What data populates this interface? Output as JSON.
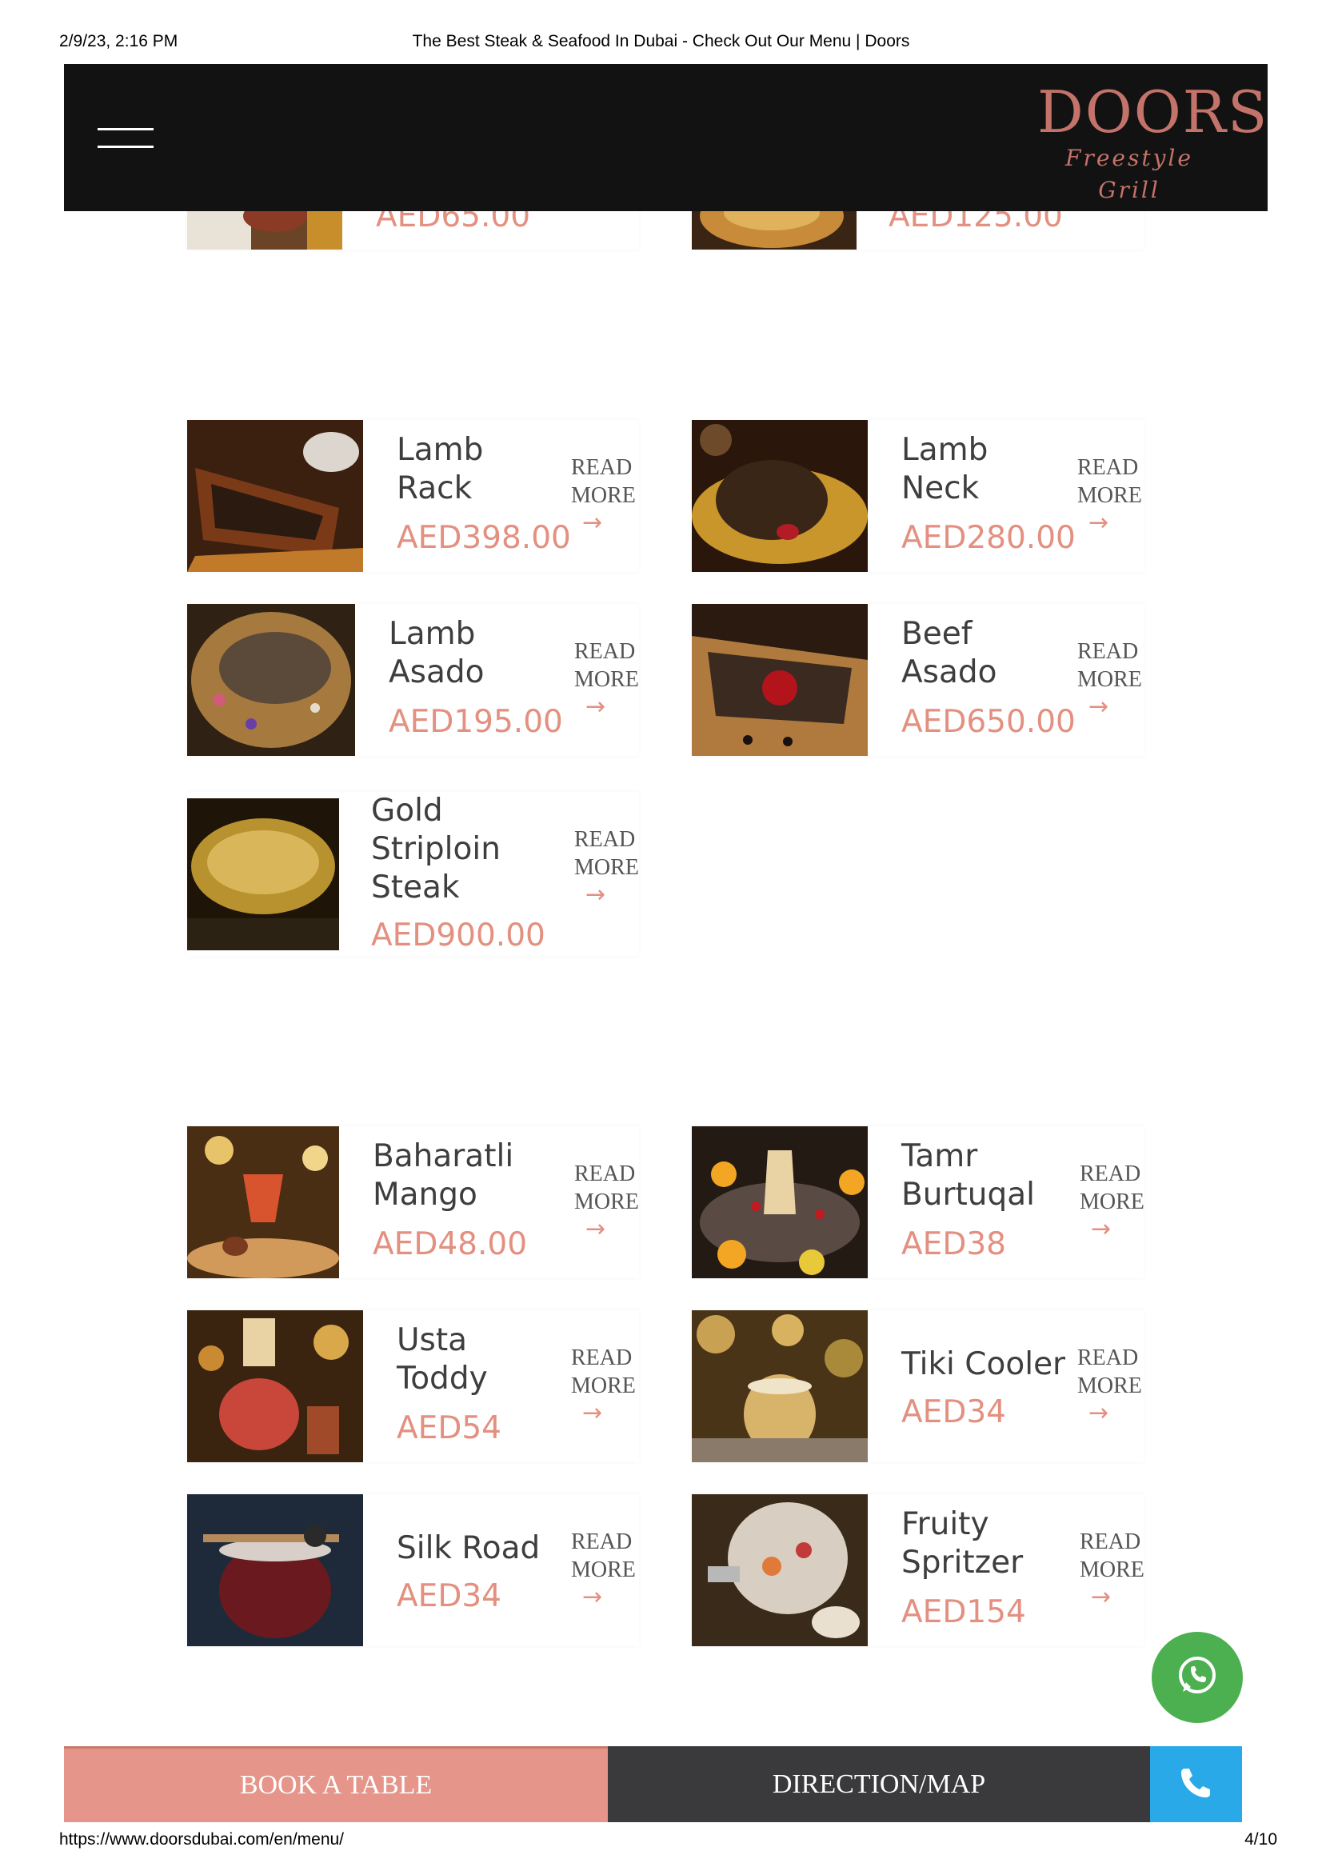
{
  "print_header": {
    "date": "2/9/23, 2:16 PM",
    "title": "The Best Steak & Seafood In Dubai - Check Out Our Menu | Doors"
  },
  "header": {
    "logo_main": "DOORS",
    "logo_sub": "Freestyle Grill"
  },
  "partial_row": {
    "left_price": "AED65.00",
    "right_price": "AED125.00"
  },
  "read_more_label": "READ MORE",
  "arrow": "→",
  "section_1": [
    {
      "name": "Lamb Rack",
      "price": "AED398.00"
    },
    {
      "name": "Lamb Neck",
      "price": "AED280.00"
    },
    {
      "name": "Lamb Asado",
      "price": "AED195.00"
    },
    {
      "name": "Beef Asado",
      "price": "AED650.00"
    },
    {
      "name": "Gold Striploin Steak",
      "price": "AED900.00"
    }
  ],
  "section_2": [
    {
      "name": "Baharatli Mango",
      "price": "AED48.00"
    },
    {
      "name": "Tamr Burtuqal",
      "price": "AED38"
    },
    {
      "name": "Usta Toddy",
      "price": "AED54"
    },
    {
      "name": "Tiki Cooler",
      "price": "AED34"
    },
    {
      "name": "Silk Road",
      "price": "AED34"
    },
    {
      "name": "Fruity Spritzer",
      "price": "AED154"
    }
  ],
  "bottom_bar": {
    "book_label": "BOOK A TABLE",
    "direction_label": "DIRECTION/MAP"
  },
  "icons": {
    "menu": "hamburger-menu-icon",
    "whatsapp": "whatsapp-icon",
    "phone": "phone-icon"
  },
  "colors": {
    "accent": "#e39080",
    "header_bg": "#121212",
    "book_bg": "#e59589",
    "direction_bg": "#3a393b",
    "phone_bg": "#29a9e8",
    "whatsapp_bg": "#4caf50"
  },
  "print_footer": {
    "url": "https://www.doorsdubai.com/en/menu/",
    "page": "4/10"
  }
}
